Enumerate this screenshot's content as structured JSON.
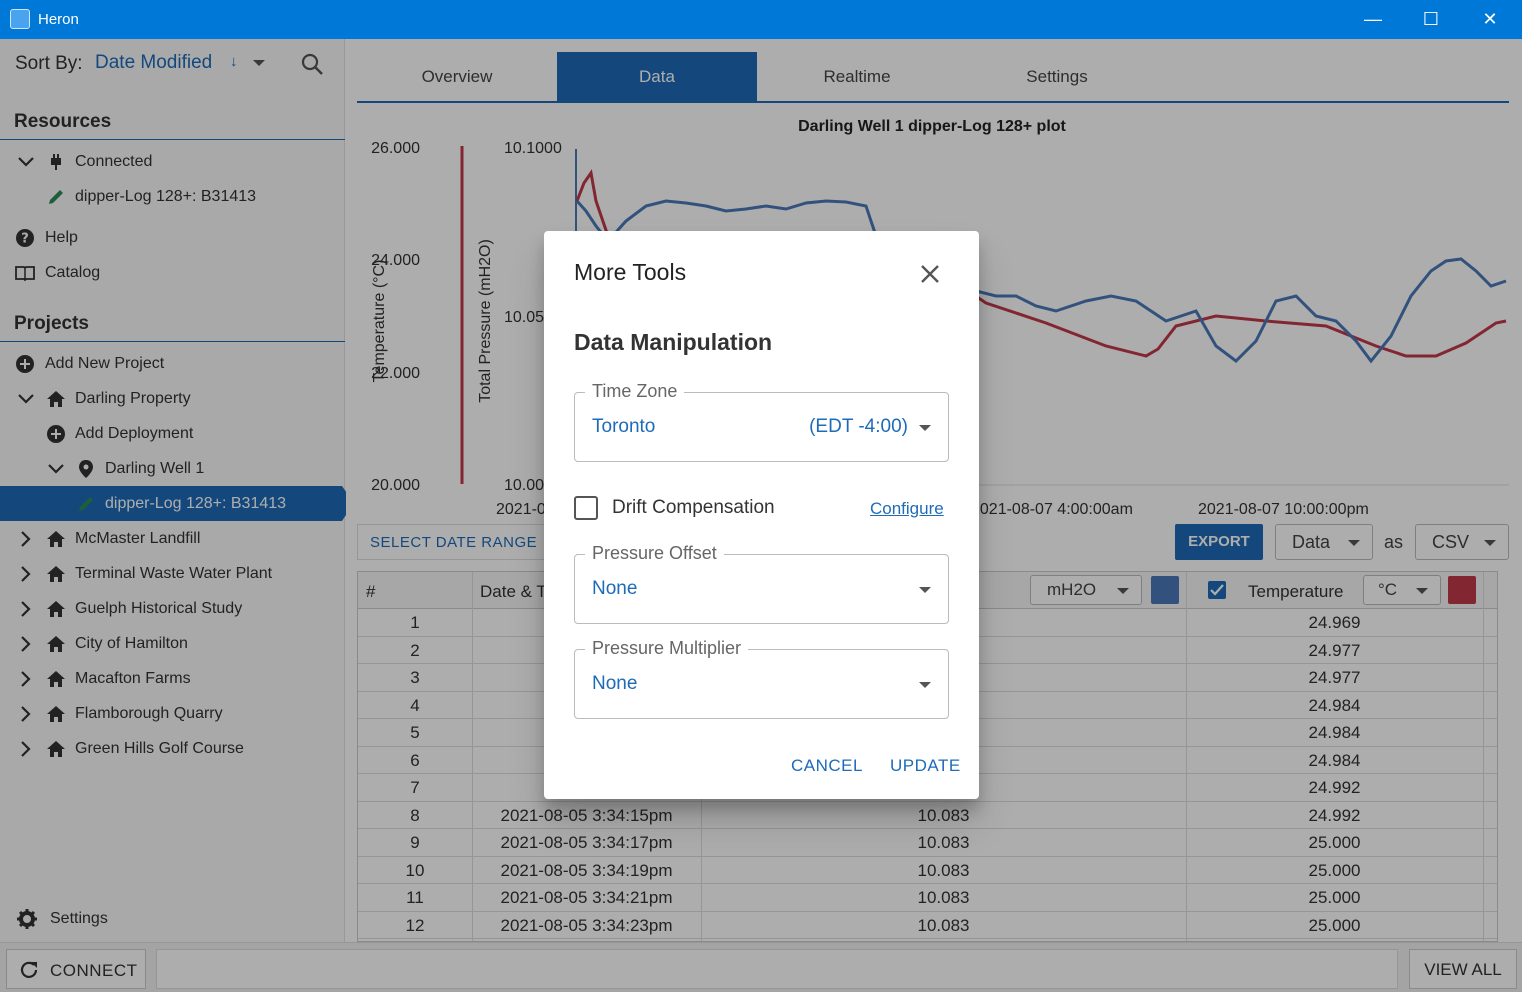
{
  "window": {
    "title": "Heron",
    "minimize_glyph": "—",
    "maximize_glyph": "☐",
    "close_glyph": "✕"
  },
  "sidebar": {
    "sort_label": "Sort By:",
    "sort_value": "Date Modified",
    "sort_direction_glyph": "↓",
    "resources_heading": "Resources",
    "resources": [
      {
        "label": "Connected",
        "icon": "plug-icon"
      },
      {
        "label": "dipper-Log 128+: B31413",
        "icon": "pencil-icon"
      },
      {
        "label": "Help",
        "icon": "help-icon"
      },
      {
        "label": "Catalog",
        "icon": "book-icon"
      }
    ],
    "projects_heading": "Projects",
    "projects": [
      {
        "label": "Add New Project",
        "icon": "add-circle-icon"
      },
      {
        "label": "Darling Property",
        "icon": "home-icon"
      },
      {
        "label": "Add Deployment",
        "icon": "add-circle-icon"
      },
      {
        "label": "Darling Well 1",
        "icon": "location-pin-icon"
      },
      {
        "label": "dipper-Log 128+: B31413",
        "icon": "pencil-icon"
      },
      {
        "label": "McMaster Landfill",
        "icon": "home-icon"
      },
      {
        "label": "Terminal Waste Water Plant",
        "icon": "home-icon"
      },
      {
        "label": "Guelph Historical Study",
        "icon": "home-icon"
      },
      {
        "label": "City of Hamilton",
        "icon": "home-icon"
      },
      {
        "label": "Macafton Farms",
        "icon": "home-icon"
      },
      {
        "label": "Flamborough Quarry",
        "icon": "home-icon"
      },
      {
        "label": "Green Hills Golf Course",
        "icon": "home-icon"
      }
    ],
    "settings_label": "Settings"
  },
  "bottombar": {
    "connect_label": "CONNECT",
    "view_all_label": "VIEW ALL"
  },
  "tabs": [
    {
      "label": "Overview"
    },
    {
      "label": "Data",
      "active": true
    },
    {
      "label": "Realtime"
    },
    {
      "label": "Settings"
    }
  ],
  "chart_data": {
    "type": "line",
    "title": "Darling Well 1 dipper-Log 128+ plot",
    "y_left_label": "Temperature (°C)",
    "y_right_label": "Total Pressure (mH2O)",
    "y_left_ticks": [
      "26.000",
      "24.000",
      "22.000",
      "20.000"
    ],
    "y_right_ticks": [
      "10.1000",
      "10.05",
      "10.00"
    ],
    "x_ticks": [
      "2021-0",
      "2021-08-07 4:00:00am",
      "2021-08-07 10:00:00pm"
    ],
    "series": [
      {
        "name": "Pressure",
        "color": "#4a7ab8"
      },
      {
        "name": "Temperature",
        "color": "#c0394b"
      }
    ]
  },
  "toolbar": {
    "select_date_range": "SELECT DATE RANGE",
    "export": "EXPORT",
    "export_type": "Data",
    "as_label": "as",
    "export_format": "CSV"
  },
  "grid": {
    "headers": {
      "index": "#",
      "datetime": "Date & T",
      "pressure_unit": "mH2O",
      "temperature": "Temperature",
      "temperature_unit": "°C"
    },
    "pressure_color": "#4a7ab8",
    "temperature_color": "#c0394b",
    "rows": [
      {
        "n": "1",
        "dt": "2021-",
        "p": "",
        "t": "24.969"
      },
      {
        "n": "2",
        "dt": "2021-",
        "p": "",
        "t": "24.977"
      },
      {
        "n": "3",
        "dt": "2021-",
        "p": "",
        "t": "24.977"
      },
      {
        "n": "4",
        "dt": "2021-",
        "p": "",
        "t": "24.984"
      },
      {
        "n": "5",
        "dt": "2021-",
        "p": "",
        "t": "24.984"
      },
      {
        "n": "6",
        "dt": "2021-",
        "p": "",
        "t": "24.984"
      },
      {
        "n": "7",
        "dt": "2021-",
        "p": "",
        "t": "24.992"
      },
      {
        "n": "8",
        "dt": "2021-08-05 3:34:15pm",
        "p": "10.083",
        "t": "24.992"
      },
      {
        "n": "9",
        "dt": "2021-08-05 3:34:17pm",
        "p": "10.083",
        "t": "25.000"
      },
      {
        "n": "10",
        "dt": "2021-08-05 3:34:19pm",
        "p": "10.083",
        "t": "25.000"
      },
      {
        "n": "11",
        "dt": "2021-08-05 3:34:21pm",
        "p": "10.083",
        "t": "25.000"
      },
      {
        "n": "12",
        "dt": "2021-08-05 3:34:23pm",
        "p": "10.083",
        "t": "25.000"
      }
    ]
  },
  "dialog": {
    "title": "More Tools",
    "section": "Data Manipulation",
    "time_zone_label": "Time Zone",
    "time_zone_value": "Toronto",
    "time_zone_offset": "(EDT -4:00)",
    "drift_label": "Drift Compensation",
    "drift_checked": false,
    "configure_label": "Configure",
    "pressure_offset_label": "Pressure Offset",
    "pressure_offset_value": "None",
    "pressure_multiplier_label": "Pressure Multiplier",
    "pressure_multiplier_value": "None",
    "cancel_label": "CANCEL",
    "update_label": "UPDATE"
  },
  "colors": {
    "accent": "#1e6bb8",
    "titlebar": "#0078d7"
  }
}
